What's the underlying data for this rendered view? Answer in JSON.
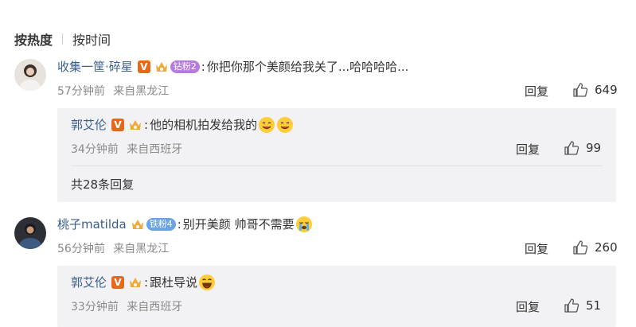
{
  "sort": {
    "active": "按热度",
    "other": "按时间"
  },
  "comments": [
    {
      "user": "收集一筐·碎星",
      "fan_label": "钻粉2",
      "text": "你把你那个美颜给我关了...哈哈哈哈...",
      "time": "57分钟前",
      "location": "来自黑龙江",
      "reply_label": "回复",
      "likes": "649",
      "replies": [
        {
          "user": "郭艾伦",
          "text": "他的相机拍发给我的",
          "time": "34分钟前",
          "location": "来自西班牙",
          "reply_label": "回复",
          "likes": "99"
        }
      ],
      "more_replies": "共28条回复"
    },
    {
      "user": "桃子matilda",
      "fan_label": "铁粉4",
      "text": "别开美颜 帅哥不需要",
      "time": "56分钟前",
      "location": "来自黑龙江",
      "reply_label": "回复",
      "likes": "260",
      "replies": [
        {
          "user": "郭艾伦",
          "text": "跟杜导说",
          "time": "33分钟前",
          "location": "来自西班牙",
          "reply_label": "回复",
          "likes": "51"
        }
      ]
    }
  ],
  "colors": {
    "username": "#3a5f8f",
    "meta": "#8a8a8a",
    "reply_bg": "#f2f2f5",
    "badge_v": "#e8681a",
    "fan_purple": "#b57bde",
    "fan_blue": "#6aa3e6"
  },
  "icons": {
    "verified": "verified-v-icon",
    "crown": "fan-crown-icon",
    "like": "thumbs-up-icon",
    "emoji_yum": "yum-emoji-icon",
    "emoji_cry": "crying-emoji-icon",
    "emoji_laugh": "laugh-emoji-icon"
  }
}
